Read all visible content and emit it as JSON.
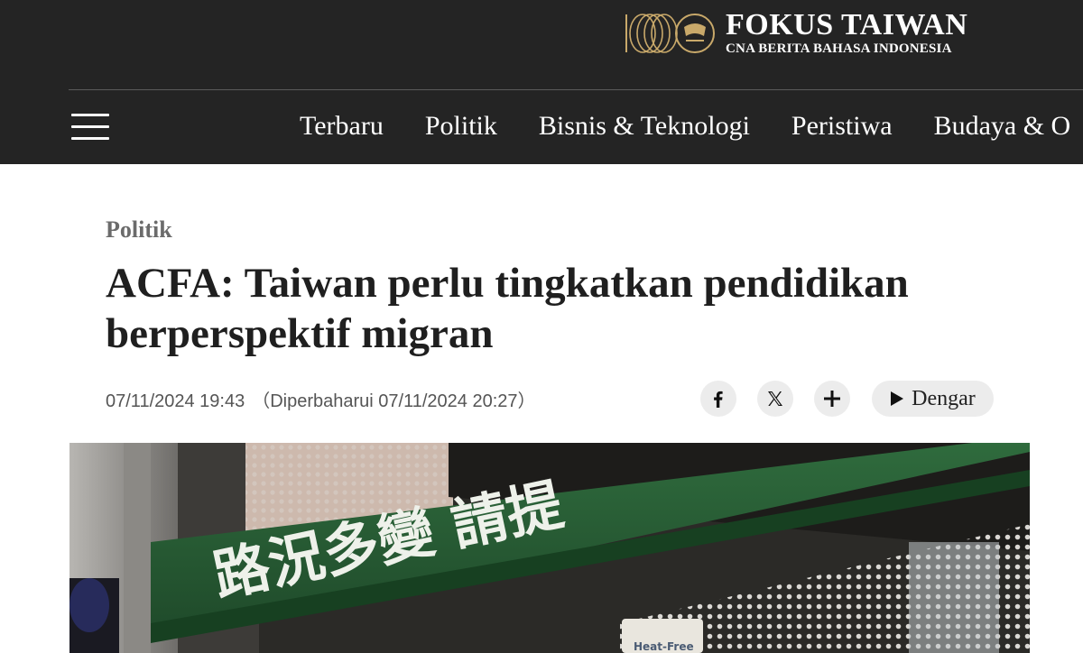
{
  "brand": {
    "title": "FOKUS TAIWAN",
    "subtitle": "CNA BERITA BAHASA INDONESIA"
  },
  "nav": {
    "items": [
      {
        "label": "Terbaru"
      },
      {
        "label": "Politik"
      },
      {
        "label": "Bisnis & Teknologi"
      },
      {
        "label": "Peristiwa"
      },
      {
        "label": "Budaya & O"
      }
    ]
  },
  "article": {
    "category": "Politik",
    "title": "ACFA: Taiwan perlu tingkatkan pendidikan berperspektif migran",
    "published": "07/11/2024 19:43",
    "updated": "（Diperbaharui 07/11/2024 20:27）"
  },
  "share": {
    "listen_label": "Dengar"
  },
  "hero": {
    "sign_text": "路況多變 請提",
    "sticker_text": "Heat-Free"
  },
  "colors": {
    "header_bg": "#242424",
    "button_bg": "#ececec",
    "brand_gold": "#c9a96a"
  }
}
